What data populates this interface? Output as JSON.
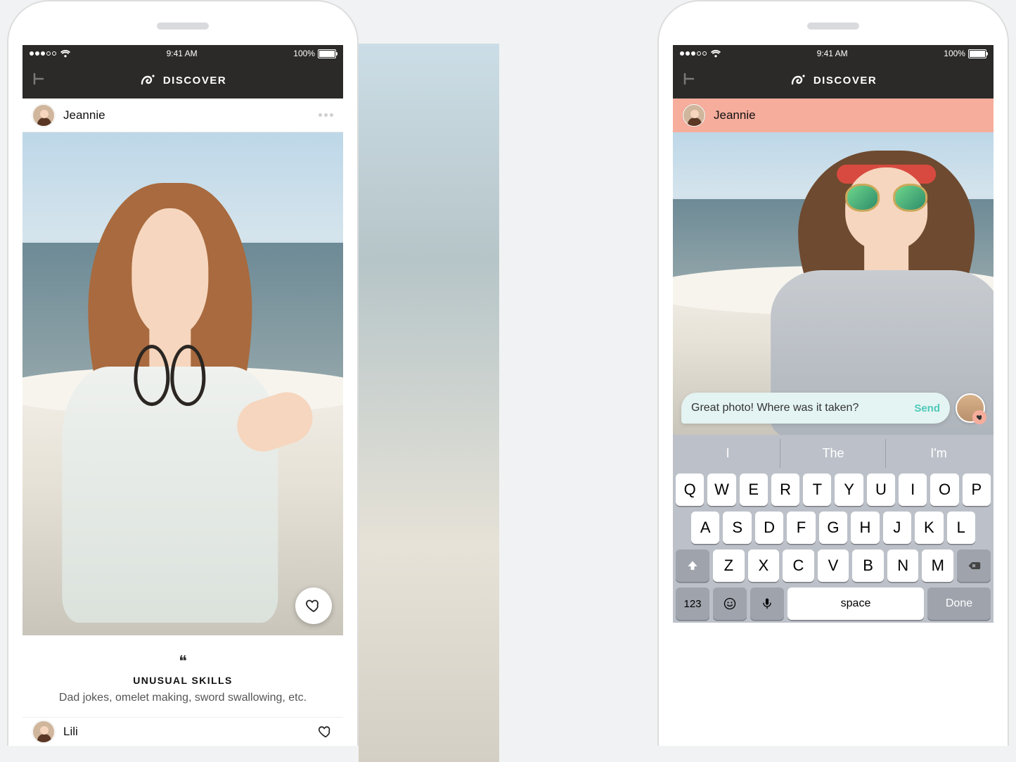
{
  "status": {
    "time": "9:41 AM",
    "battery": "100%"
  },
  "header": {
    "title": "DISCOVER"
  },
  "phone1": {
    "profile": {
      "name": "Jeannie"
    },
    "skills": {
      "title": "UNUSUAL SKILLS",
      "body": "Dad jokes, omelet making, sword swallowing, etc."
    },
    "peek": {
      "name": "Lili"
    }
  },
  "phone2": {
    "profile": {
      "name": "Jeannie"
    },
    "message": {
      "text": "Great photo! Where was it taken?",
      "send": "Send"
    },
    "keyboard": {
      "suggestions": [
        "I",
        "The",
        "I'm"
      ],
      "row1": [
        "Q",
        "W",
        "E",
        "R",
        "T",
        "Y",
        "U",
        "I",
        "O",
        "P"
      ],
      "row2": [
        "A",
        "S",
        "D",
        "F",
        "G",
        "H",
        "J",
        "K",
        "L"
      ],
      "row3": [
        "Z",
        "X",
        "C",
        "V",
        "B",
        "N",
        "M"
      ],
      "num": "123",
      "space": "space",
      "done": "Done"
    }
  }
}
